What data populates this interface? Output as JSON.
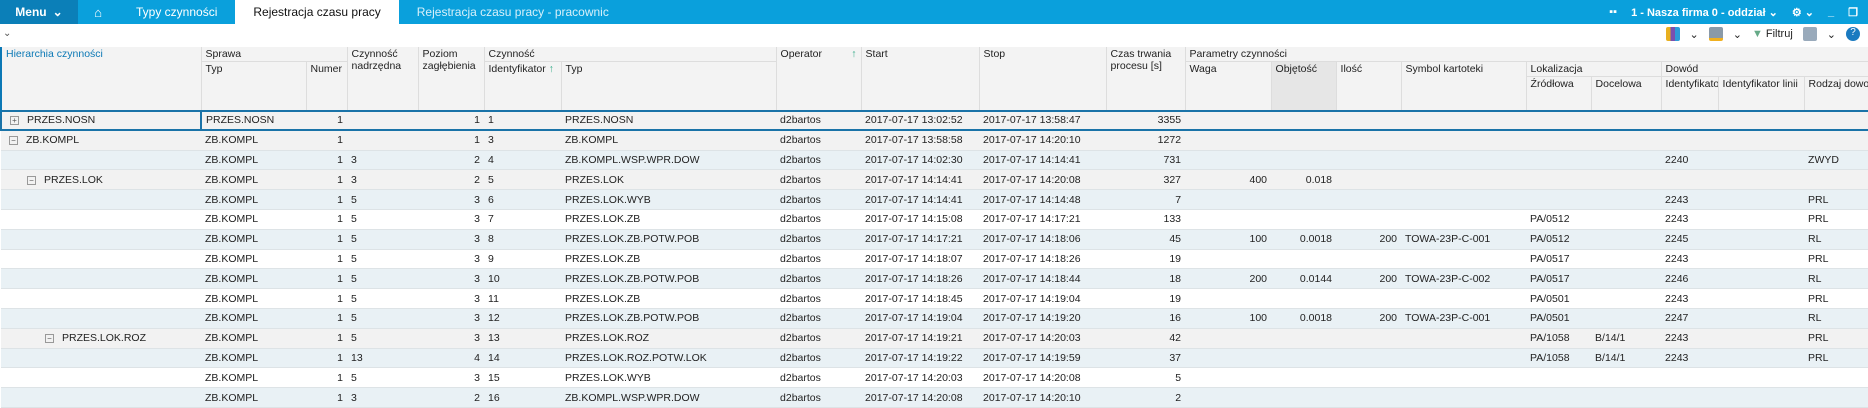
{
  "topbar": {
    "menu": "Menu",
    "tabs": [
      "Typy czynności",
      "Rejestracja czasu pracy",
      "Rejestracja czasu pracy - pracownic"
    ],
    "company": "1 - Nasza firma 0 - oddział"
  },
  "toolbar": {
    "filter": "Filtruj"
  },
  "headers": {
    "hier": "Hierarchia czynności",
    "sprawa": "Sprawa",
    "typ": "Typ",
    "numer": "Numer",
    "nadrz1": "Czynność",
    "nadrz2": "nadrzędna",
    "poziom1": "Poziom",
    "poziom2": "zagłębienia",
    "czynnosc": "Czynność",
    "ident": "Identyfikator",
    "ctyp": "Typ",
    "operator": "Operator",
    "start": "Start",
    "stop": "Stop",
    "czas1": "Czas trwania",
    "czas2": "procesu [s]",
    "params": "Parametry czynności",
    "waga": "Waga",
    "obj": "Objętość",
    "ilosc": "Ilość",
    "symbol": "Symbol kartoteki",
    "lok": "Lokalizacja",
    "zrod": "Źródłowa",
    "doc": "Docelowa",
    "dowod": "Dowód",
    "did": "Identyfikator",
    "dlin": "Identyfikator linii",
    "drodz": "Rodzaj dowodu"
  },
  "rows": [
    [
      "PRZES.NOSN",
      "+",
      "PRZES.NOSN",
      "1",
      "",
      "1",
      "1",
      "PRZES.NOSN",
      "d2bartos",
      "2017-07-17 13:02:52",
      "2017-07-17 13:58:47",
      "3355",
      "",
      "",
      "",
      "",
      "",
      "",
      "",
      "",
      "",
      ""
    ],
    [
      "ZB.KOMPL",
      "−",
      "ZB.KOMPL",
      "1",
      "",
      "1",
      "3",
      "ZB.KOMPL",
      "d2bartos",
      "2017-07-17 13:58:58",
      "2017-07-17 14:20:10",
      "1272",
      "",
      "",
      "",
      "",
      "",
      "",
      "",
      "",
      "",
      ""
    ],
    [
      "",
      "",
      "ZB.KOMPL",
      "1",
      "3",
      "2",
      "4",
      "ZB.KOMPL.WSP.WPR.DOW",
      "d2bartos",
      "2017-07-17 14:02:30",
      "2017-07-17 14:14:41",
      "731",
      "",
      "",
      "",
      "",
      "",
      "",
      "2240",
      "",
      "ZWYD"
    ],
    [
      "PRZES.LOK",
      "−",
      "ZB.KOMPL",
      "1",
      "3",
      "2",
      "5",
      "PRZES.LOK",
      "d2bartos",
      "2017-07-17 14:14:41",
      "2017-07-17 14:20:08",
      "327",
      "400",
      "0.018",
      "",
      "",
      "",
      "",
      "",
      "",
      ""
    ],
    [
      "",
      "",
      "ZB.KOMPL",
      "1",
      "5",
      "3",
      "6",
      "PRZES.LOK.WYB",
      "d2bartos",
      "2017-07-17 14:14:41",
      "2017-07-17 14:14:48",
      "7",
      "",
      "",
      "",
      "",
      "",
      "",
      "2243",
      "",
      "PRL"
    ],
    [
      "",
      "",
      "ZB.KOMPL",
      "1",
      "5",
      "3",
      "7",
      "PRZES.LOK.ZB",
      "d2bartos",
      "2017-07-17 14:15:08",
      "2017-07-17 14:17:21",
      "133",
      "",
      "",
      "",
      "",
      "PA/0512",
      "",
      "2243",
      "",
      "PRL"
    ],
    [
      "",
      "",
      "ZB.KOMPL",
      "1",
      "5",
      "3",
      "8",
      "PRZES.LOK.ZB.POTW.POB",
      "d2bartos",
      "2017-07-17 14:17:21",
      "2017-07-17 14:18:06",
      "45",
      "100",
      "0.0018",
      "200",
      "TOWA-23P-C-001",
      "PA/0512",
      "",
      "2245",
      "",
      "RL"
    ],
    [
      "",
      "",
      "ZB.KOMPL",
      "1",
      "5",
      "3",
      "9",
      "PRZES.LOK.ZB",
      "d2bartos",
      "2017-07-17 14:18:07",
      "2017-07-17 14:18:26",
      "19",
      "",
      "",
      "",
      "",
      "PA/0517",
      "",
      "2243",
      "",
      "PRL"
    ],
    [
      "",
      "",
      "ZB.KOMPL",
      "1",
      "5",
      "3",
      "10",
      "PRZES.LOK.ZB.POTW.POB",
      "d2bartos",
      "2017-07-17 14:18:26",
      "2017-07-17 14:18:44",
      "18",
      "200",
      "0.0144",
      "200",
      "TOWA-23P-C-002",
      "PA/0517",
      "",
      "2246",
      "",
      "RL"
    ],
    [
      "",
      "",
      "ZB.KOMPL",
      "1",
      "5",
      "3",
      "11",
      "PRZES.LOK.ZB",
      "d2bartos",
      "2017-07-17 14:18:45",
      "2017-07-17 14:19:04",
      "19",
      "",
      "",
      "",
      "",
      "PA/0501",
      "",
      "2243",
      "",
      "PRL"
    ],
    [
      "",
      "",
      "ZB.KOMPL",
      "1",
      "5",
      "3",
      "12",
      "PRZES.LOK.ZB.POTW.POB",
      "d2bartos",
      "2017-07-17 14:19:04",
      "2017-07-17 14:19:20",
      "16",
      "100",
      "0.0018",
      "200",
      "TOWA-23P-C-001",
      "PA/0501",
      "",
      "2247",
      "",
      "RL"
    ],
    [
      "PRZES.LOK.ROZ",
      "−",
      "ZB.KOMPL",
      "1",
      "5",
      "3",
      "13",
      "PRZES.LOK.ROZ",
      "d2bartos",
      "2017-07-17 14:19:21",
      "2017-07-17 14:20:03",
      "42",
      "",
      "",
      "",
      "",
      "PA/1058",
      "B/14/1",
      "2243",
      "",
      "PRL"
    ],
    [
      "",
      "",
      "ZB.KOMPL",
      "1",
      "13",
      "4",
      "14",
      "PRZES.LOK.ROZ.POTW.LOK",
      "d2bartos",
      "2017-07-17 14:19:22",
      "2017-07-17 14:19:59",
      "37",
      "",
      "",
      "",
      "",
      "PA/1058",
      "B/14/1",
      "2243",
      "",
      "PRL"
    ],
    [
      "",
      "",
      "ZB.KOMPL",
      "1",
      "5",
      "3",
      "15",
      "PRZES.LOK.WYB",
      "d2bartos",
      "2017-07-17 14:20:03",
      "2017-07-17 14:20:08",
      "5",
      "",
      "",
      "",
      "",
      "",
      "",
      "",
      "",
      ""
    ],
    [
      "",
      "",
      "ZB.KOMPL",
      "1",
      "3",
      "2",
      "16",
      "ZB.KOMPL.WSP.WPR.DOW",
      "d2bartos",
      "2017-07-17 14:20:08",
      "2017-07-17 14:20:10",
      "2",
      "",
      "",
      "",
      "",
      "",
      "",
      "",
      "",
      ""
    ]
  ],
  "row_styles": [
    "sel",
    "g",
    "b",
    "g",
    "b",
    "w",
    "b",
    "w",
    "b",
    "w",
    "b",
    "g",
    "b",
    "w",
    "b"
  ],
  "row_indent": [
    1,
    1,
    0,
    2,
    0,
    0,
    0,
    0,
    0,
    0,
    0,
    3,
    0,
    0,
    0
  ]
}
